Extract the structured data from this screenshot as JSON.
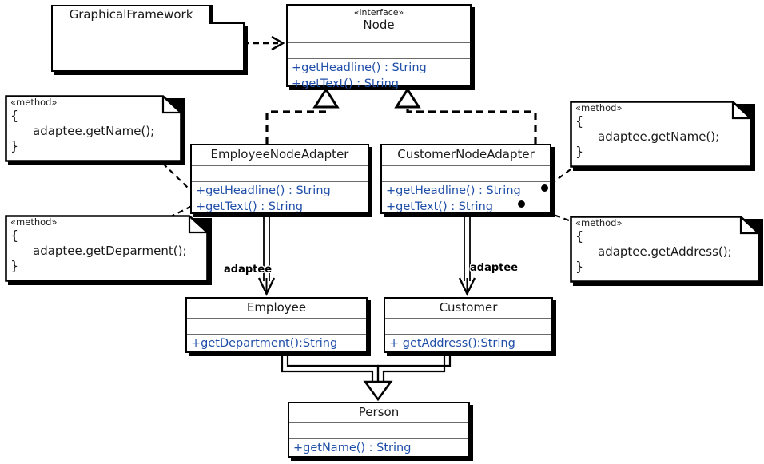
{
  "diagram": {
    "title": "Adapter pattern UML class diagram",
    "colors": {
      "member_text": "#1f4fa8",
      "class_text": "#1a1a1a",
      "line": "#000000",
      "background": "#ffffff"
    }
  },
  "package": {
    "name": "GraphicalFramework"
  },
  "classes": [
    {
      "id": "node",
      "stereotype": "«interface»",
      "name": "Node",
      "attributes": [],
      "operations": [
        "+getHeadline() : String",
        "+getText() : String"
      ]
    },
    {
      "id": "employee_node_adapter",
      "stereotype": "",
      "name": "EmployeeNodeAdapter",
      "attributes": [],
      "operations": [
        "+getHeadline() : String",
        "+getText() : String"
      ]
    },
    {
      "id": "customer_node_adapter",
      "stereotype": "",
      "name": "CustomerNodeAdapter",
      "attributes": [],
      "operations": [
        "+getHeadline() : String",
        "+getText() : String"
      ]
    },
    {
      "id": "employee",
      "stereotype": "",
      "name": "Employee",
      "attributes": [],
      "operations": [
        "+getDepartment():String"
      ]
    },
    {
      "id": "customer",
      "stereotype": "",
      "name": "Customer",
      "attributes": [],
      "operations": [
        "+ getAddress():String"
      ]
    },
    {
      "id": "person",
      "stereotype": "",
      "name": "Person",
      "attributes": [],
      "operations": [
        "+getName() : String"
      ]
    }
  ],
  "notes": [
    {
      "id": "note_left_top",
      "stereotype": "«method»",
      "open_brace": "{",
      "body": "adaptee.getName();",
      "close_brace": "}"
    },
    {
      "id": "note_left_bottom",
      "stereotype": "«method»",
      "open_brace": "{",
      "body": "adaptee.getDeparment();",
      "close_brace": "}"
    },
    {
      "id": "note_right_top",
      "stereotype": "«method»",
      "open_brace": "{",
      "body": "adaptee.getName();",
      "close_brace": "}"
    },
    {
      "id": "note_right_bottom",
      "stereotype": "«method»",
      "open_brace": "{",
      "body": "adaptee.getAddress();",
      "close_brace": "}"
    }
  ],
  "edge_labels": {
    "employee_adaptee": "adaptee",
    "customer_adaptee": "adaptee"
  }
}
